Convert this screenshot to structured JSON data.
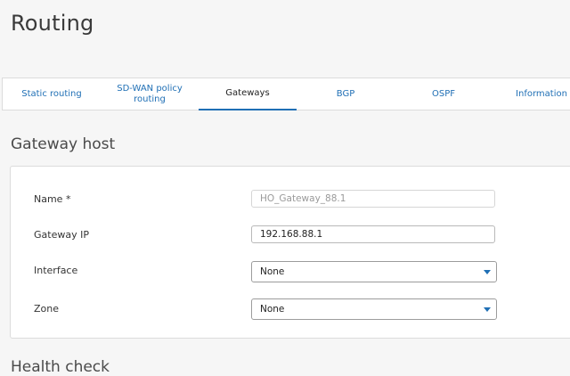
{
  "page": {
    "title": "Routing"
  },
  "tabs": [
    {
      "label": "Static routing"
    },
    {
      "label": "SD-WAN policy routing"
    },
    {
      "label": "Gateways"
    },
    {
      "label": "BGP"
    },
    {
      "label": "OSPF"
    },
    {
      "label": "Information"
    }
  ],
  "active_tab": "Gateways",
  "gateway_host": {
    "section_title": "Gateway host",
    "name": {
      "label": "Name *",
      "value": "HO_Gateway_88.1"
    },
    "gateway_ip": {
      "label": "Gateway IP",
      "value": "192.168.88.1"
    },
    "interface": {
      "label": "Interface",
      "value": "None"
    },
    "zone": {
      "label": "Zone",
      "value": "None"
    }
  },
  "health_check": {
    "section_title": "Health check"
  },
  "colors": {
    "accent": "#1f6fb5",
    "background": "#f6f6f6",
    "panel": "#ffffff"
  },
  "icons": {
    "dropdown": "chevron-down-icon"
  }
}
